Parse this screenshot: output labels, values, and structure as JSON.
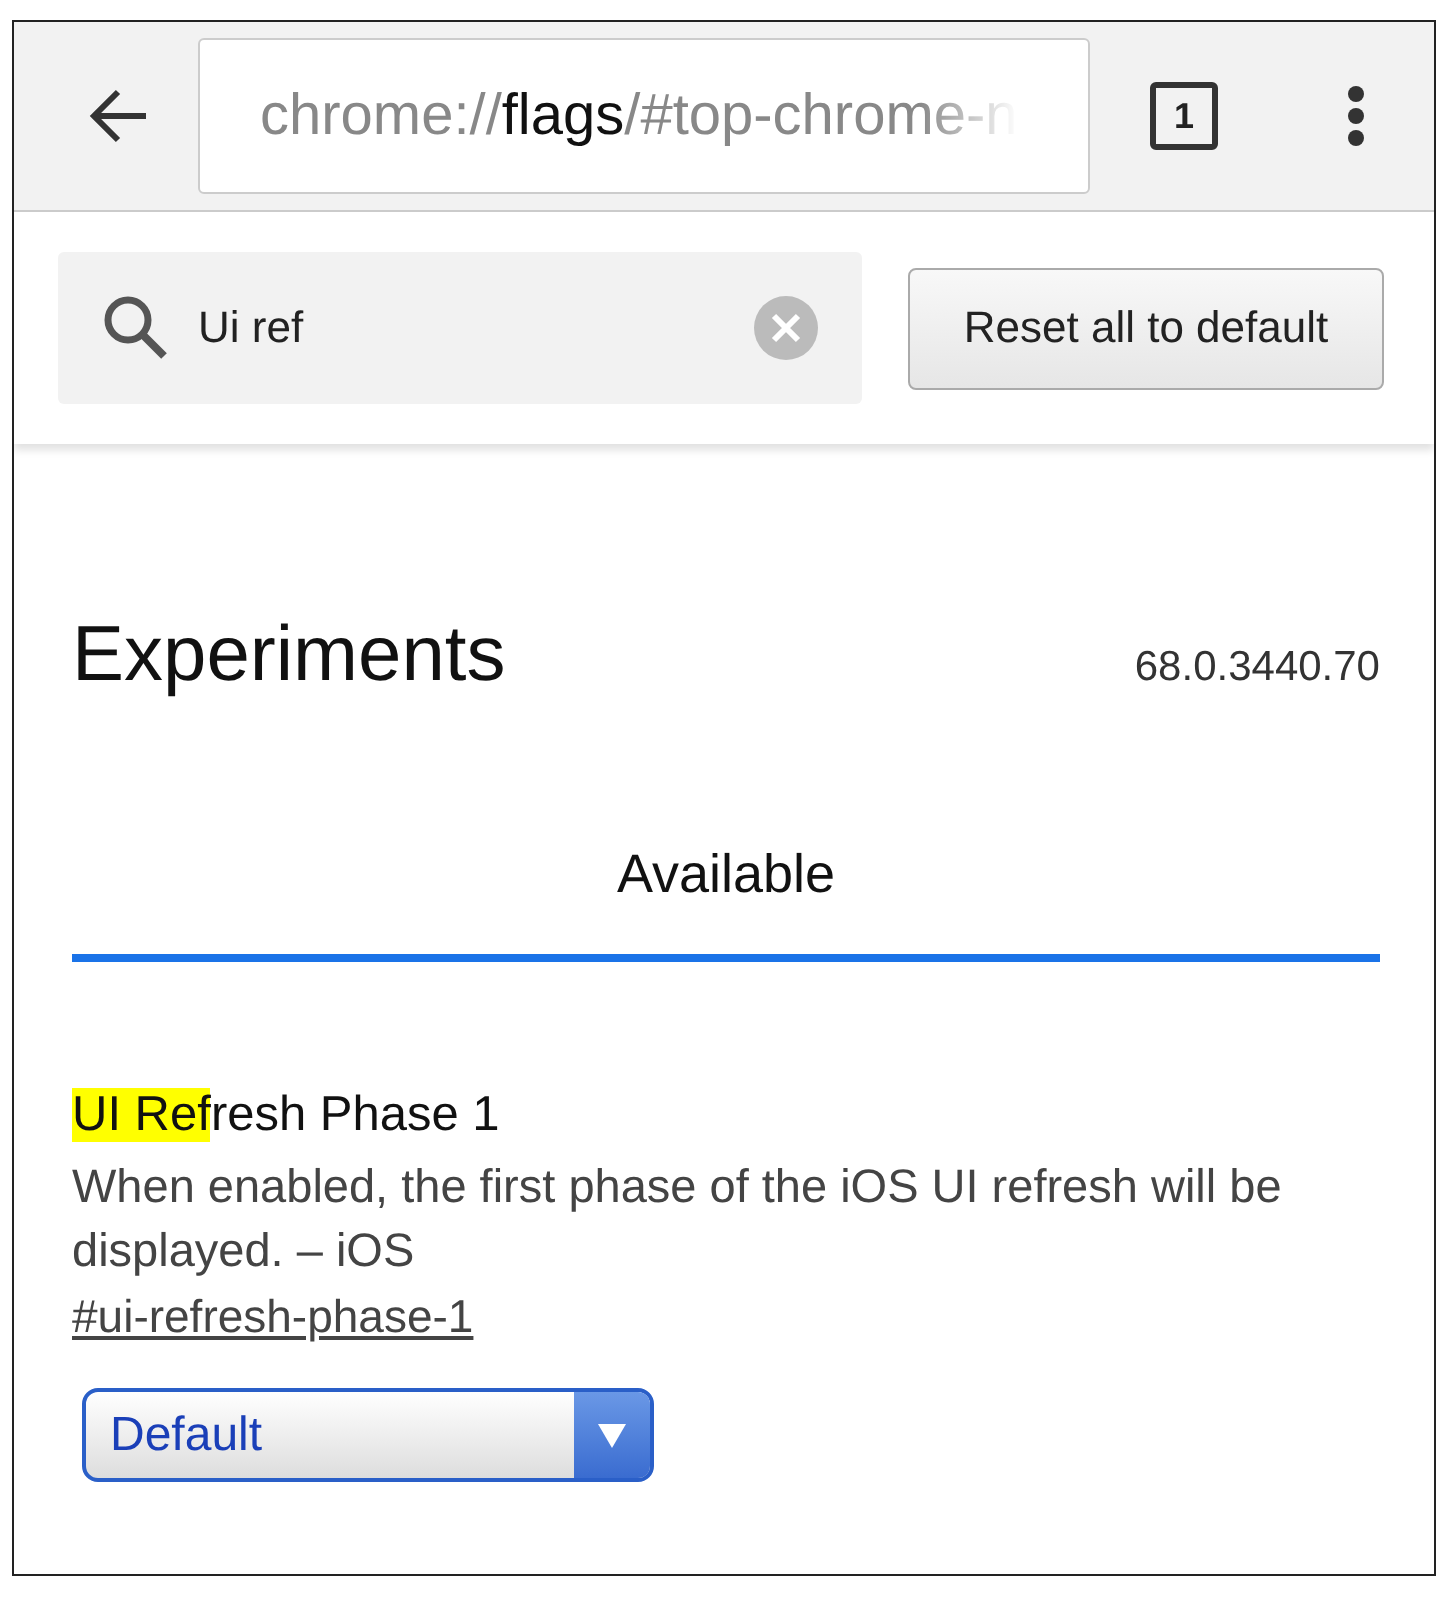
{
  "toolbar": {
    "url": {
      "scheme": "chrome://",
      "host": "flags",
      "path": "/#top-chrome-n"
    },
    "tab_count": "1"
  },
  "search": {
    "value": "Ui ref"
  },
  "reset_button": "Reset all to default",
  "heading": "Experiments",
  "version": "68.0.3440.70",
  "tabs": [
    {
      "label": "Available",
      "selected": true
    }
  ],
  "flags": [
    {
      "title_parts": [
        {
          "text": "UI Ref",
          "highlighted": true
        },
        {
          "text": "resh Phase 1",
          "highlighted": false
        }
      ],
      "description": "When enabled, the first phase of the iOS UI refresh will be displayed. – iOS",
      "link": "#ui-refresh-phase-1",
      "select": "Default"
    }
  ]
}
